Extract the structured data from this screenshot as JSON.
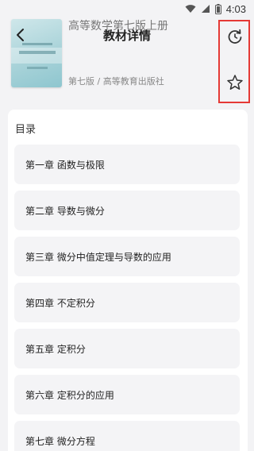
{
  "status": {
    "time": "4:03"
  },
  "header": {
    "book_title": "高等数学第七版上册",
    "page_title": "教材详情",
    "book_meta": "第七版 / 高等教育出版社"
  },
  "toc": {
    "section_title": "目录",
    "chapters": [
      "第一章 函数与极限",
      "第二章 导数与微分",
      "第三章 微分中值定理与导数的应用",
      "第四章 不定积分",
      "第五章 定积分",
      "第六章 定积分的应用",
      "第七章 微分方程"
    ]
  },
  "colors": {
    "highlight": "#e53935",
    "background": "#f3f3f5",
    "card": "#f4f4f6"
  },
  "icons": [
    "wifi-icon",
    "signal-icon",
    "battery-icon",
    "back-arrow-icon",
    "refresh-icon",
    "star-icon"
  ]
}
